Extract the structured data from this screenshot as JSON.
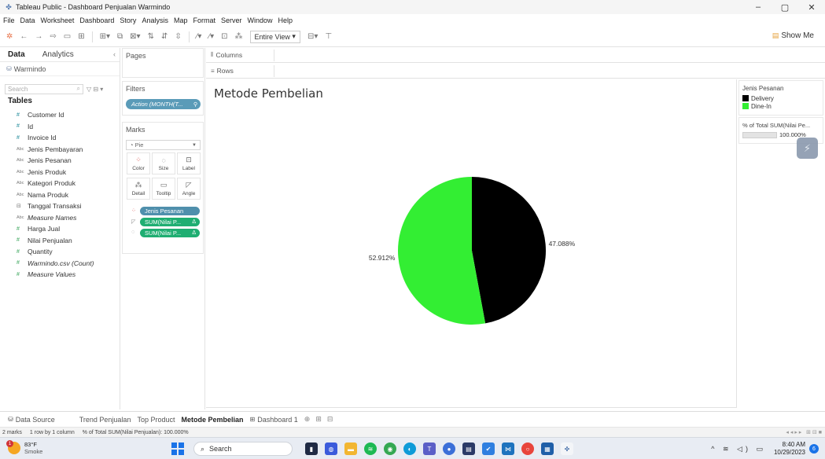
{
  "window": {
    "title": "Tableau Public - Dashboard Penjualan Warmindo",
    "controls": [
      "–",
      "▢",
      "✕"
    ]
  },
  "menu": [
    "File",
    "Data",
    "Worksheet",
    "Dashboard",
    "Story",
    "Analysis",
    "Map",
    "Format",
    "Server",
    "Window",
    "Help"
  ],
  "toolbar": {
    "fit_mode": "Entire View",
    "show_me": "Show Me"
  },
  "left_pane": {
    "tab_data": "Data",
    "tab_analytics": "Analytics",
    "datasource": "Warmindo",
    "search_placeholder": "Search",
    "tables_heading": "Tables",
    "fields": [
      {
        "label": "Customer Id",
        "kind": "num"
      },
      {
        "label": "Id",
        "kind": "num"
      },
      {
        "label": "Invoice Id",
        "kind": "num"
      },
      {
        "label": "Jenis Pembayaran",
        "kind": "abc"
      },
      {
        "label": "Jenis Pesanan",
        "kind": "abc"
      },
      {
        "label": "Jenis Produk",
        "kind": "abc"
      },
      {
        "label": "Kategori Produk",
        "kind": "abc"
      },
      {
        "label": "Nama Produk",
        "kind": "abc"
      },
      {
        "label": "Tanggal Transaksi",
        "kind": "date"
      },
      {
        "label": "Measure Names",
        "kind": "abc",
        "italic": true
      },
      {
        "label": "Harga Jual",
        "kind": "meas"
      },
      {
        "label": "Nilai Penjualan",
        "kind": "meas"
      },
      {
        "label": "Quantity",
        "kind": "meas"
      },
      {
        "label": "Warmindo.csv (Count)",
        "kind": "meas",
        "italic": true
      },
      {
        "label": "Measure Values",
        "kind": "meas",
        "italic": true
      }
    ]
  },
  "cards": {
    "pages": "Pages",
    "filters": "Filters",
    "filter_pill": "Action (MONTH(T...",
    "marks": "Marks",
    "mark_type": "Pie",
    "buttons": {
      "color": "Color",
      "size": "Size",
      "label": "Label",
      "detail": "Detail",
      "tooltip": "Tooltip",
      "angle": "Angle"
    },
    "mark_pills": [
      "Jenis Pesanan",
      "SUM(Nilai P...",
      "SUM(Nilai P..."
    ]
  },
  "shelves": {
    "columns": "Columns",
    "rows": "Rows"
  },
  "viz": {
    "title": "Metode Pembelian"
  },
  "chart_data": {
    "type": "pie",
    "title": "Metode Pembelian",
    "categories": [
      "Delivery",
      "Dine-In"
    ],
    "values": [
      47.088,
      52.912
    ],
    "labels": [
      "47.088%",
      "52.912%"
    ],
    "colors": [
      "#000000",
      "#33ee33"
    ],
    "legend_title": "Jenis Pesanan",
    "legend_position": "right"
  },
  "size_legend": {
    "title": "% of Total SUM(Nilai Pe...",
    "value": "100.000%"
  },
  "sheet_tabs": {
    "datasource": "Data Source",
    "tabs": [
      "Trend Penjualan",
      "Top Product",
      "Metode Pembelian",
      "Dashboard 1"
    ],
    "active": "Metode Pembelian"
  },
  "status": {
    "marks": "2 marks",
    "dims": "1 row by 1 column",
    "summary": "% of Total SUM(Nilai Penjualan): 100.000%"
  },
  "taskbar": {
    "temp": "83°F",
    "condition": "Smoke",
    "weather_badge": "1",
    "search": "Search",
    "time": "8:40 AM",
    "date": "10/29/2023",
    "notif": "6"
  }
}
